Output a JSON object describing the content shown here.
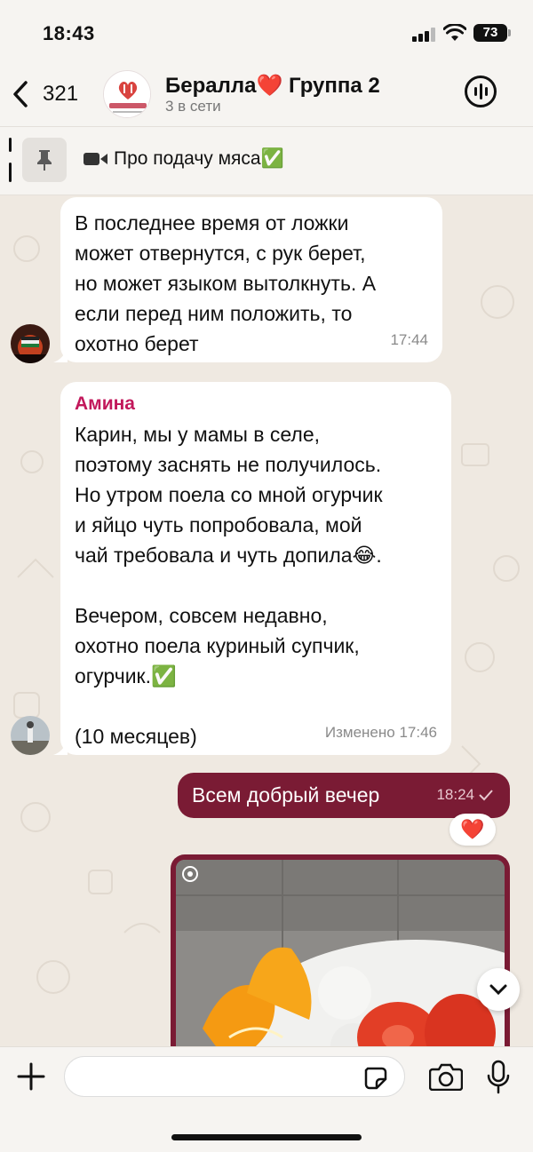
{
  "status_bar": {
    "time": "18:43",
    "battery": "73"
  },
  "header": {
    "back_count": "321",
    "group_title": "Бералла❤️ Группа 2",
    "online": "3 в сети",
    "logo_text": "Бералла"
  },
  "pinned": {
    "label": "Про подачу мяса✅"
  },
  "messages": [
    {
      "text": "В последнее время от ложки\nможет отвернутся, с рук берет,\nно может языком вытолкнуть. А\nесли перед ним положить, то\nохотно берет",
      "time": "17:44"
    },
    {
      "sender": "Амина",
      "text": "Карин, мы у мамы в селе,\nпоэтому заснять не получилось.\nНо утром поела со мной огурчик\nи яйцо чуть попробовала, мой\nчай требовала и чуть допила😂.\n\nВечером, совсем недавно,\nохотно поела куриный супчик,\nогурчик.✅\n\n(10 месяцев)",
      "time": "Изменено 17:46"
    },
    {
      "text": "Всем добрый вечер",
      "time": "18:24",
      "reaction": "❤️"
    }
  ],
  "input": {
    "placeholder": ""
  },
  "colors": {
    "outgoing": "#7a1b34",
    "sender_name": "#c2185b",
    "background": "#efe9e1"
  }
}
